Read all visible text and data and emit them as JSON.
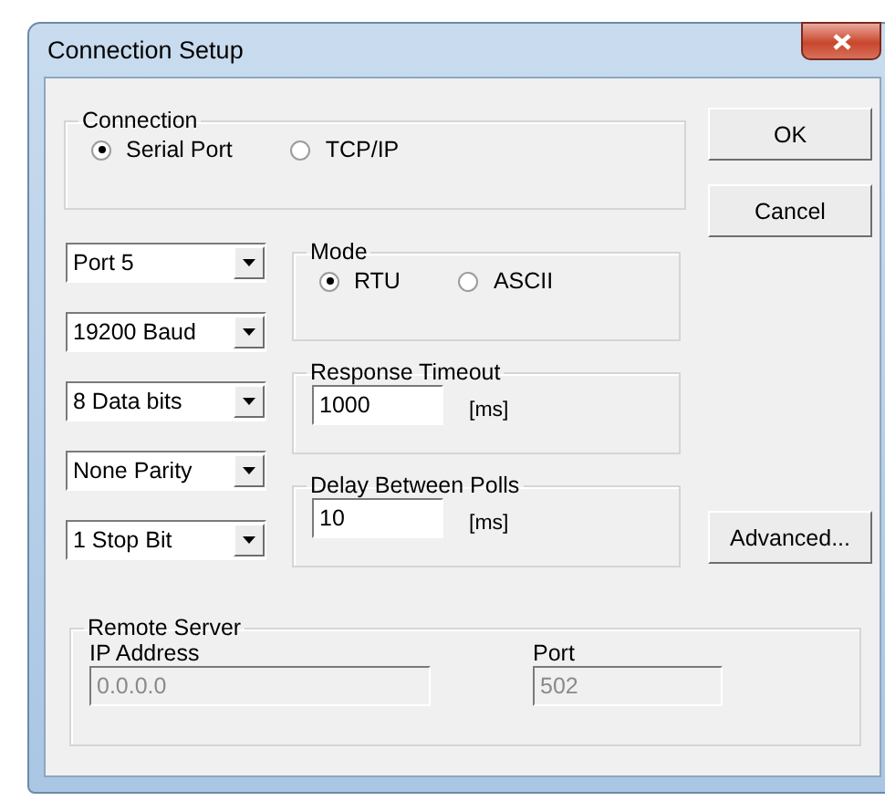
{
  "window": {
    "title": "Connection Setup"
  },
  "connection": {
    "label": "Connection",
    "options": [
      {
        "label": "Serial Port",
        "selected": true
      },
      {
        "label": "TCP/IP",
        "selected": false
      }
    ]
  },
  "combos": [
    {
      "value": "Port 5"
    },
    {
      "value": "19200 Baud"
    },
    {
      "value": "8 Data bits"
    },
    {
      "value": "None Parity"
    },
    {
      "value": "1 Stop Bit"
    }
  ],
  "mode": {
    "label": "Mode",
    "options": [
      {
        "label": "RTU",
        "selected": true
      },
      {
        "label": "ASCII",
        "selected": false
      }
    ]
  },
  "response_timeout": {
    "label": "Response Timeout",
    "value": "1000",
    "unit": "[ms]"
  },
  "delay_between_polls": {
    "label": "Delay Between Polls",
    "value": "10",
    "unit": "[ms]"
  },
  "remote_server": {
    "label": "Remote Server",
    "fields": [
      {
        "label": "IP Address",
        "value": "0.0.0.0",
        "disabled": true
      },
      {
        "label": "Port",
        "value": "502",
        "disabled": true
      }
    ]
  },
  "buttons": [
    "OK",
    "Cancel",
    "Advanced..."
  ]
}
